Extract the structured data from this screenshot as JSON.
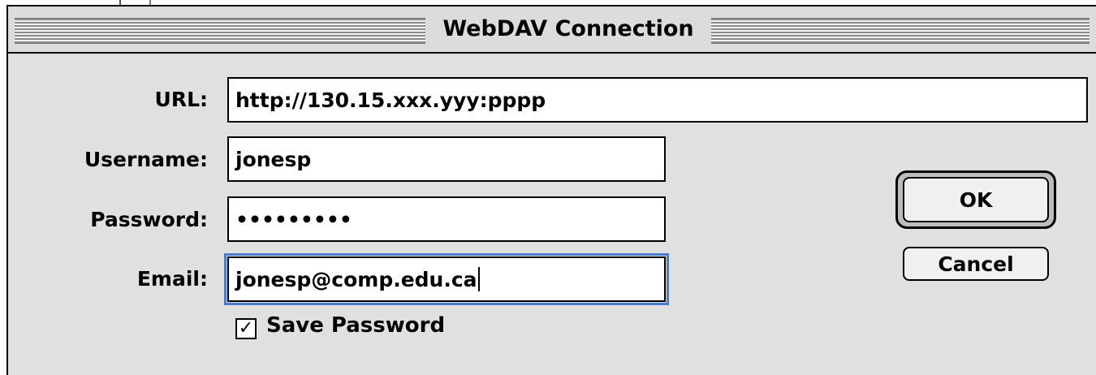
{
  "window": {
    "title": "WebDAV Connection"
  },
  "form": {
    "url": {
      "label": "URL:",
      "value": "http://130.15.xxx.yyy:pppp"
    },
    "username": {
      "label": "Username:",
      "value": "jonesp"
    },
    "password": {
      "label": "Password:",
      "value": "•••••••••"
    },
    "email": {
      "label": "Email:",
      "value": "jonesp@comp.edu.ca",
      "focused": true
    },
    "save_password": {
      "label": "Save Password",
      "checked": true
    }
  },
  "buttons": {
    "ok": "OK",
    "cancel": "Cancel"
  },
  "colors": {
    "focus_ring": "#4a7bd1",
    "background": "#e0e0e0"
  }
}
